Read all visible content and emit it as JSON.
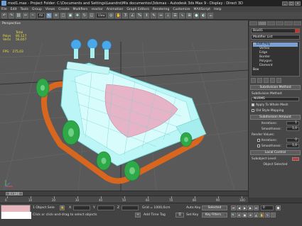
{
  "window": {
    "title": "mod1.max - Project Folder: C:\\Documents and Settings\\Leandro\\Mis documentos\\3dsmax - Autodesk 3ds Max 9 - Display : Direct 3D",
    "buttons": [
      "_",
      "□",
      "×"
    ]
  },
  "menu": [
    "File",
    "Edit",
    "Tools",
    "Group",
    "Views",
    "Create",
    "Modifiers",
    "reactor",
    "Animation",
    "Graph Editors",
    "Rendering",
    "Customize",
    "MAXScript",
    "Help"
  ],
  "toolbar": {
    "selection_filter": "All",
    "coord_system": "View"
  },
  "viewport": {
    "label": "Perspective",
    "stats": {
      "header": "Total",
      "polys_label": "Polys",
      "polys_value": "80,127",
      "verts_label": "Verts",
      "verts_value": "56,607",
      "fps_label": "FPS:",
      "fps_value": "275,03"
    }
  },
  "command_panel": {
    "object_name": "Box01",
    "modifier_list": "Modifier List",
    "stack": [
      {
        "label": "Edit Poly",
        "level": "top"
      },
      {
        "label": "Vertex",
        "level": "sub"
      },
      {
        "label": "Edge",
        "level": "sub"
      },
      {
        "label": "Border",
        "level": "sub"
      },
      {
        "label": "Polygon",
        "level": "sub"
      },
      {
        "label": "Element",
        "level": "sub"
      },
      {
        "label": "Box",
        "level": "top"
      }
    ],
    "rollouts": {
      "subdivision_method": "Subdivision Method",
      "subdivision_amount": "Subdivision Amount",
      "local_control": "Local Control"
    },
    "subdivision_method_label": "Subdivision Method:",
    "subdivision_method_value": "NURMS",
    "apply_to_whole_mesh": "Apply To Whole Mesh",
    "old_style_mapping": "Old Style Mapping",
    "iterations_label": "Iterations:",
    "iterations_value": "1",
    "smoothness_label": "Smoothness:",
    "smoothness_value": "1,0",
    "render_values_label": "Render Values:",
    "render_iterations_label": "Iterations:",
    "render_iterations_value": "0",
    "render_smoothness_label": "Smoothness:",
    "render_smoothness_value": "1,0",
    "subobject_level_label": "Subobject Level:",
    "subobject_level_value": "",
    "object_selected": "Object Selected"
  },
  "timeline": {
    "slider": "0 / 100",
    "ticks": [
      "0",
      "10",
      "20",
      "30",
      "40",
      "50",
      "60",
      "70",
      "80",
      "90",
      "100"
    ]
  },
  "status": {
    "selection": "1 Object Sele",
    "prompt": "Click or click-and-drag to select objects",
    "x_label": "X",
    "y_label": "Y",
    "z_label": "Z",
    "grid": "Grid = 1000,0cm",
    "add_time_tag": "Add Time Tag",
    "auto_key": "Auto Key",
    "set_key": "Set Key",
    "auto_key_mode": "Selected",
    "key_filters": "Key Filters...",
    "frame": "0"
  },
  "colors": {
    "stats_text": "#e8e040",
    "selected_modifier": "#7d9fcf",
    "wheel_green": "#2fa84a",
    "track_orange": "#d9661f",
    "body_cyan": "#a8f0f0",
    "light_blue": "#4aa8e8"
  }
}
